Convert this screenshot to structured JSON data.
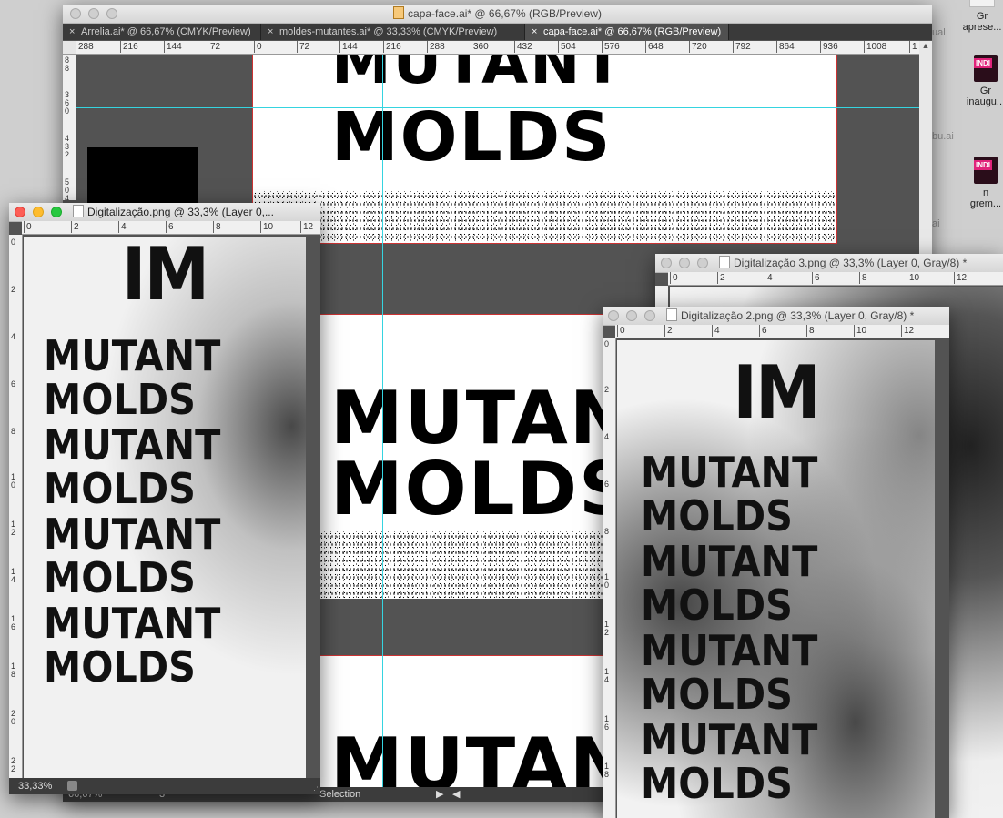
{
  "desktop": {
    "icons": [
      {
        "label": "Gr",
        "label2": "aprese..."
      },
      {
        "label": "Gr",
        "label2": "inaugu..."
      },
      {
        "label": "n",
        "label2": "grem..."
      }
    ],
    "partial_labels": [
      "ual",
      "bu.ai",
      "ai"
    ],
    "ind_badge": "INDI"
  },
  "main_window": {
    "title": "capa-face.ai* @ 66,67% (RGB/Preview)",
    "tabs": [
      {
        "label": "Arrelia.ai* @ 66,67% (CMYK/Preview)"
      },
      {
        "label": "moldes-mutantes.ai* @ 33,33% (CMYK/Preview)"
      },
      {
        "label": "capa-face.ai* @ 66,67% (RGB/Preview)"
      }
    ],
    "ruler_h": [
      "288",
      "216",
      "144",
      "72",
      "0",
      "72",
      "144",
      "216",
      "288",
      "360",
      "432",
      "504",
      "576",
      "648",
      "720",
      "792",
      "864",
      "936",
      "1008",
      "1"
    ],
    "ruler_v": [
      "8 8",
      "3 6 0",
      "4 3 2",
      "5 0 4"
    ],
    "art_line1": "MUTANT",
    "art_line2": "MOLDS",
    "status_zoom": "66,67%",
    "status_page": "3",
    "status_tool": "Selection"
  },
  "win_dig1": {
    "title": "Digitalização.png @ 33,3% (Layer 0,...",
    "ruler_h": [
      "0",
      "2",
      "4",
      "6",
      "8",
      "10",
      "12"
    ],
    "ruler_v": [
      "0",
      "2",
      "4",
      "6",
      "8",
      "1 0",
      "1 2",
      "1 4",
      "1 6",
      "1 8",
      "2 0",
      "2 2"
    ],
    "lines": [
      "IM",
      "MUTANT",
      "MOLDS",
      "MUTANT",
      "MOLDS",
      "MUTANT",
      "MOLDS",
      "MUTANT",
      "MOLDS"
    ],
    "zoom": "33,33%"
  },
  "win_dig3": {
    "title": "Digitalização 3.png @ 33,3% (Layer 0, Gray/8) *",
    "ruler_h": [
      "0",
      "2",
      "4",
      "6",
      "8",
      "10",
      "12"
    ]
  },
  "win_dig2": {
    "title": "Digitalização 2.png @ 33,3% (Layer 0, Gray/8) *",
    "ruler_h": [
      "0",
      "2",
      "4",
      "6",
      "8",
      "10",
      "12"
    ],
    "ruler_v": [
      "0",
      "2",
      "4",
      "6",
      "8",
      "1 0",
      "1 2",
      "1 4",
      "1 6",
      "1 8"
    ],
    "lines": [
      "IM",
      "MUTANT",
      "MOLDS",
      "MUTANT",
      "MOLDS",
      "MUTANT",
      "MOLDS",
      "MUTANT",
      "MOLDS"
    ]
  }
}
